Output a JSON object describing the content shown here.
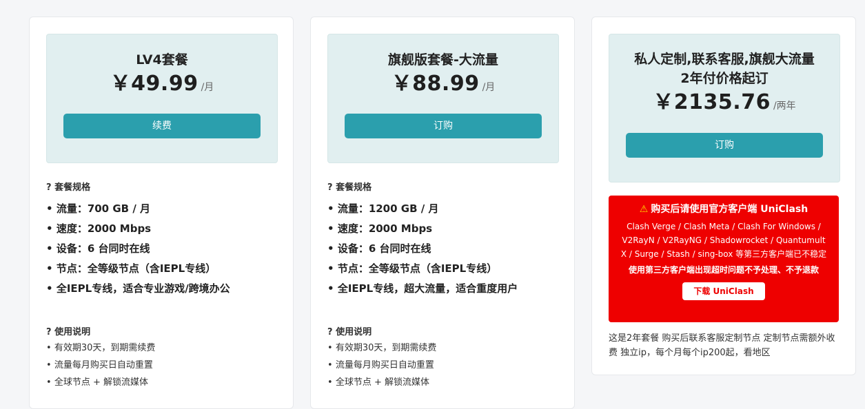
{
  "plans": [
    {
      "title": "LV4套餐",
      "price": "￥49.99",
      "unit": "/月",
      "button": "续费",
      "spec_title": "? 套餐规格",
      "specs": [
        "流量：700 GB / 月",
        "速度：2000 Mbps",
        "设备：6 台同时在线",
        "节点：全等级节点（含IEPL专线）",
        "全IEPL专线，适合专业游戏/跨境办公"
      ],
      "usage_title": "? 使用说明",
      "usage": [
        "有效期30天，到期需续费",
        "流量每月购买日自动重置",
        "全球节点 + 解锁流媒体"
      ]
    },
    {
      "title": "旗舰版套餐-大流量",
      "price": "￥88.99",
      "unit": "/月",
      "button": "订购",
      "spec_title": "? 套餐规格",
      "specs": [
        "流量：1200 GB / 月",
        "速度：2000 Mbps",
        "设备：6 台同时在线",
        "节点：全等级节点（含IEPL专线）",
        "全IEPL专线，超大流量，适合重度用户"
      ],
      "usage_title": "? 使用说明",
      "usage": [
        "有效期30天，到期需续费",
        "流量每月购买日自动重置",
        "全球节点 + 解锁流媒体"
      ]
    },
    {
      "title_line1": "私人定制,联系客服,旗舰大流量",
      "title_line2": "2年付价格起订",
      "price": "￥2135.76",
      "unit": "/两年",
      "button": "订购",
      "warning": {
        "icon": "warning-icon",
        "title": "购买后请使用官方客户端 UniClash",
        "text": "Clash Verge / Clash Meta / Clash For Windows / V2RayN / V2RayNG / Shadowrocket / Quantumult X / Surge / Stash / sing-box 等第三方客户端已不稳定",
        "bold": "使用第三方客户端出现超时问题不予处理、不予退款",
        "download": "下载 UniClash"
      },
      "note": "这是2年套餐 购买后联系客服定制节点 定制节点需额外收费 独立ip，每个月每个ip200起，看地区"
    }
  ],
  "colors": {
    "accent": "#2b9fad",
    "price_box": "#e1eff0",
    "warning_bg": "#ee0000",
    "warning_icon": "#ffd400"
  }
}
